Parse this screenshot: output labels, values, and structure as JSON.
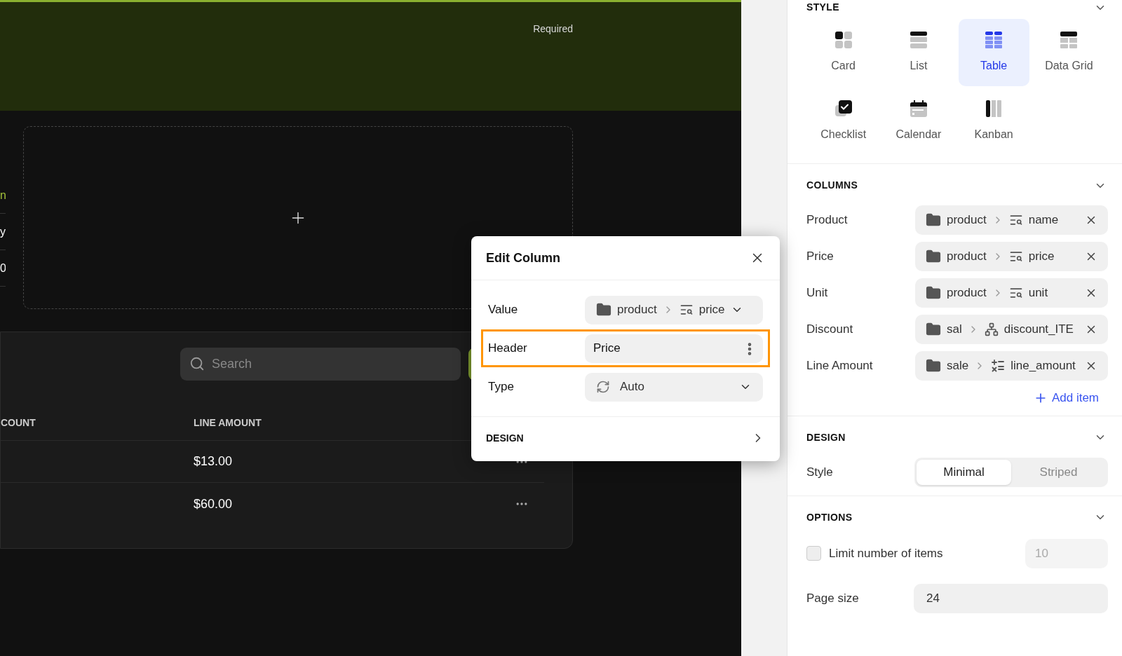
{
  "canvas": {
    "banner": {
      "hint": "Required"
    },
    "cut_labels": [
      {
        "text": "n",
        "kind": "accent"
      },
      {
        "text": "y",
        "kind": "plain"
      },
      {
        "text": "0",
        "kind": "plain"
      }
    ],
    "table": {
      "search": {
        "placeholder": "Search"
      },
      "columns": [
        "COUNT",
        "LINE AMOUNT"
      ],
      "rows": [
        {
          "line_amount": "$13.00"
        },
        {
          "line_amount": "$60.00"
        }
      ]
    }
  },
  "edit_column": {
    "title": "Edit Column",
    "fields": [
      {
        "label": "Value",
        "kind": "path",
        "source": "product",
        "field": "price",
        "focused": false
      },
      {
        "label": "Header",
        "kind": "text",
        "value": "Price",
        "focused": true
      },
      {
        "label": "Type",
        "kind": "select",
        "value": "Auto",
        "focused": false
      }
    ],
    "section": "DESIGN"
  },
  "panel": {
    "style": {
      "title": "STYLE",
      "options": [
        {
          "label": "Card",
          "kind": "card",
          "selected": false
        },
        {
          "label": "List",
          "kind": "list",
          "selected": false
        },
        {
          "label": "Table",
          "kind": "table",
          "selected": true
        },
        {
          "label": "Data Grid",
          "kind": "grid",
          "selected": false
        },
        {
          "label": "Checklist",
          "kind": "checklist",
          "selected": false
        },
        {
          "label": "Calendar",
          "kind": "calendar",
          "selected": false
        },
        {
          "label": "Kanban",
          "kind": "kanban",
          "selected": false
        }
      ]
    },
    "columns": {
      "title": "COLUMNS",
      "items": [
        {
          "label": "Product",
          "source": "product",
          "field": "name",
          "kind": "lookup"
        },
        {
          "label": "Price",
          "source": "product",
          "field": "price",
          "kind": "lookup"
        },
        {
          "label": "Unit",
          "source": "product",
          "field": "unit",
          "kind": "lookup"
        },
        {
          "label": "Discount",
          "source": "sal",
          "field": "discount_ITE",
          "kind": "relation"
        },
        {
          "label": "Line Amount",
          "source": "sale",
          "field": "line_amount",
          "kind": "formula"
        }
      ],
      "add_label": "Add item"
    },
    "design": {
      "title": "DESIGN",
      "label": "Style",
      "options": [
        {
          "label": "Minimal",
          "selected": true
        },
        {
          "label": "Striped",
          "selected": false
        }
      ]
    },
    "options": {
      "title": "OPTIONS",
      "limit": {
        "label": "Limit number of items",
        "checked": false,
        "placeholder": "10"
      },
      "page_size": {
        "label": "Page size",
        "value": "24"
      }
    }
  }
}
